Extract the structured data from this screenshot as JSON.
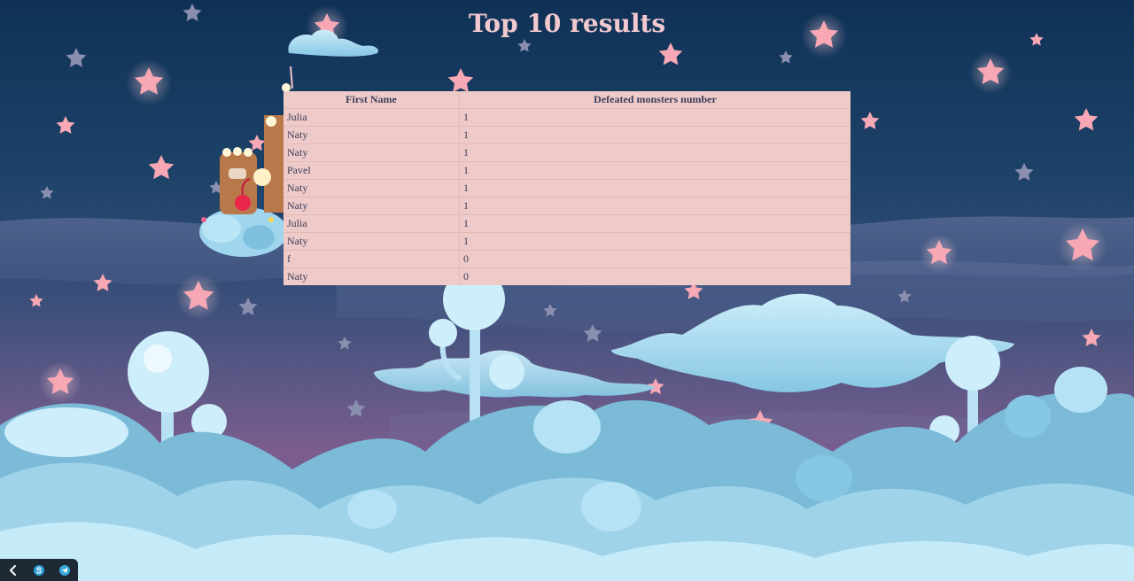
{
  "page": {
    "title": "Top 10 results"
  },
  "table": {
    "headers": [
      "First Name",
      "Defeated monsters number"
    ],
    "rows": [
      [
        "Julia",
        "1"
      ],
      [
        "Naty",
        "1"
      ],
      [
        "Naty",
        "1"
      ],
      [
        "Pavel",
        "1"
      ],
      [
        "Naty",
        "1"
      ],
      [
        "Naty",
        "1"
      ],
      [
        "Julia",
        "1"
      ],
      [
        "Naty",
        "1"
      ],
      [
        "f",
        "0"
      ],
      [
        "Naty",
        "0"
      ]
    ]
  },
  "dock": {
    "items": [
      {
        "icon": "back-arrow-icon"
      },
      {
        "icon": "skype-icon"
      },
      {
        "icon": "telegram-icon"
      }
    ]
  },
  "colors": {
    "title": "#f2c9cf",
    "table_bg": "#eecbc9",
    "table_text": "#3c3d5a",
    "sky_top": "#0f3156",
    "sky_bottom": "#7b5d8e",
    "cloud": "#a9dcef",
    "star_pink": "#f7a8b4",
    "star_dim": "#8a8fb0"
  }
}
